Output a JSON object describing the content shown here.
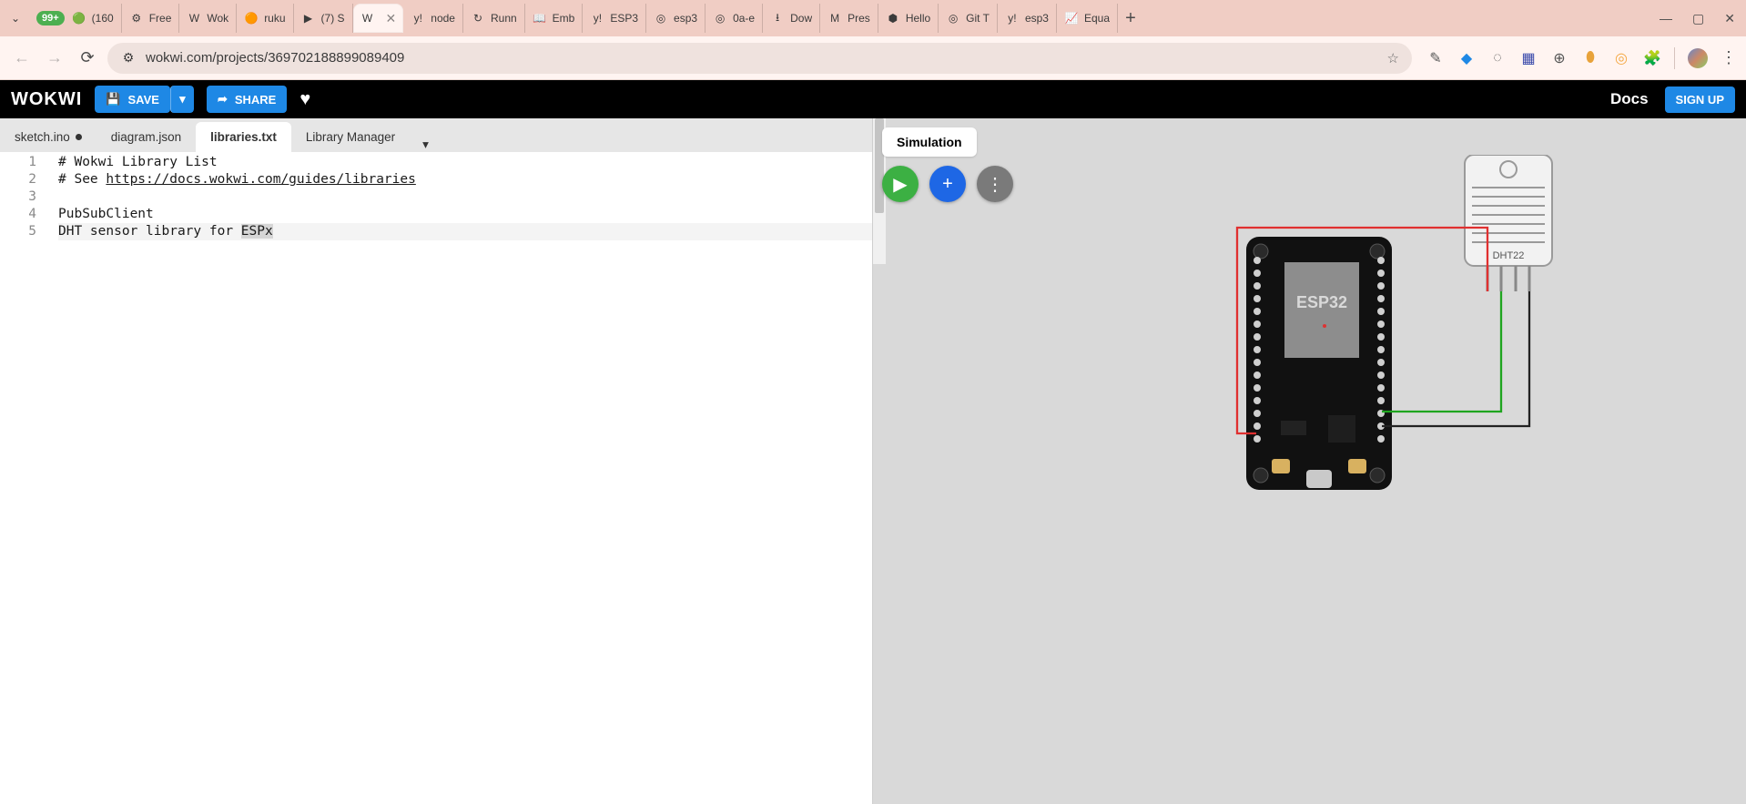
{
  "browser": {
    "ext_badge": "99+",
    "tabs": [
      {
        "title": "(160",
        "favicon": "🟢"
      },
      {
        "title": "Free",
        "favicon": "⚙"
      },
      {
        "title": "Wok",
        "favicon": "W"
      },
      {
        "title": "ruku",
        "favicon": "🟠"
      },
      {
        "title": "(7) S",
        "favicon": "▶"
      },
      {
        "title": "",
        "favicon": "W",
        "active": true,
        "closeable": true
      },
      {
        "title": "node",
        "favicon": "y!"
      },
      {
        "title": "Runn",
        "favicon": "↻"
      },
      {
        "title": "Emb",
        "favicon": "📖"
      },
      {
        "title": "ESP3",
        "favicon": "y!"
      },
      {
        "title": "esp3",
        "favicon": "◎"
      },
      {
        "title": "0a-e",
        "favicon": "◎"
      },
      {
        "title": "Dow",
        "favicon": "⭳"
      },
      {
        "title": "Pres",
        "favicon": "M"
      },
      {
        "title": "Hello",
        "favicon": "⬢"
      },
      {
        "title": "Git T",
        "favicon": "◎"
      },
      {
        "title": "esp3",
        "favicon": "y!"
      },
      {
        "title": "Equa",
        "favicon": "📈"
      }
    ],
    "url": "wokwi.com/projects/369702188899089409"
  },
  "app": {
    "logo": "WOKWI",
    "save": "SAVE",
    "share": "SHARE",
    "docs": "Docs",
    "signup": "SIGN UP"
  },
  "editor_tabs": {
    "sketch": "sketch.ino",
    "diagram": "diagram.json",
    "libraries": "libraries.txt",
    "manager": "Library Manager"
  },
  "editor": {
    "lines": [
      "# Wokwi Library List",
      "# See https://docs.wokwi.com/guides/libraries",
      "",
      "PubSubClient",
      "DHT sensor library for ESPx"
    ],
    "link_text": "https://docs.wokwi.com/guides/libraries",
    "selection": "ESPx"
  },
  "sim": {
    "tab": "Simulation",
    "board_label": "ESP32",
    "sensor_label": "DHT22"
  }
}
